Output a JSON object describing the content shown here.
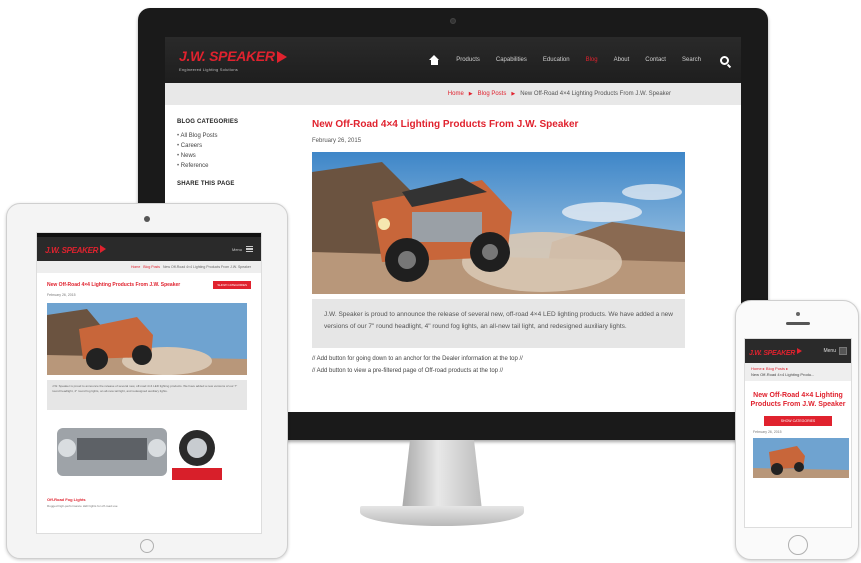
{
  "desktop": {
    "logo": {
      "name": "J.W. SPEAKER",
      "tagline": "Engineered Lighting Solutions"
    },
    "nav": {
      "items": [
        {
          "label": "Products",
          "active": false
        },
        {
          "label": "Capabilities",
          "active": false
        },
        {
          "label": "Education",
          "active": false
        },
        {
          "label": "Blog",
          "active": true
        },
        {
          "label": "About",
          "active": false
        },
        {
          "label": "Contact",
          "active": false
        }
      ],
      "search_label": "Search"
    },
    "breadcrumb": {
      "home": "Home",
      "section": "Blog Posts",
      "current": "New Off-Road 4×4 Lighting Products From J.W. Speaker"
    },
    "sidebar": {
      "heading": "BLOG CATEGORIES",
      "categories": [
        "All Blog Posts",
        "Careers",
        "News",
        "Reference"
      ],
      "share_heading": "SHARE THIS PAGE"
    },
    "post": {
      "title": "New Off-Road 4×4 Lighting Products From J.W. Speaker",
      "date": "February 26, 2015",
      "caption": "J.W. Speaker is proud to announce the release of several new, off-road 4×4 LED lighting products. We have added a new versions of our 7\" round headlight, 4\" round fog lights, an all-new tail light, and redesigned auxiliary lights.",
      "note1": "// Add button for going down to an anchor for the Dealer information at the top //",
      "note2": "// Add button to view a pre-filtered page of Off-road products at the top //"
    }
  },
  "tablet": {
    "logo": "J.W. SPEAKER",
    "menu_label": "Menu",
    "breadcrumb": {
      "home": "Home",
      "section": "Blog Posts",
      "current": "New Off-Road 4×4 Lighting Products From J.W. Speaker"
    },
    "title": "New Off-Road 4×4 Lighting Products From J.W. Speaker",
    "button": "SHOW CATEGORIES",
    "date": "February 26, 2015",
    "caption": "J.W. Speaker is proud to announce the release of several new, off-road 4×4 LED lighting products. We have added a new versions of our 7\" round headlight, 4\" round fog lights, an all-new tail light, and redesigned auxiliary lights.",
    "product_title": "Off-Road Fog Lights",
    "product_text": "Rugged high-performance LED lights for off-road use"
  },
  "phone": {
    "logo": "J.W. SPEAKER",
    "menu_label": "Menu",
    "breadcrumb": {
      "home": "Home",
      "section": "Blog Posts",
      "current": "New Off-Road 4×4 Lighting Produ..."
    },
    "title": "New Off-Road 4×4 Lighting Products From J.W. Speaker",
    "button": "SHOW CATEGORIES",
    "date": "February 26, 2015"
  },
  "colors": {
    "brand_red": "#e0222e",
    "nav_dark": "#2a2a2a",
    "caption_gray": "#e6e6e6"
  }
}
